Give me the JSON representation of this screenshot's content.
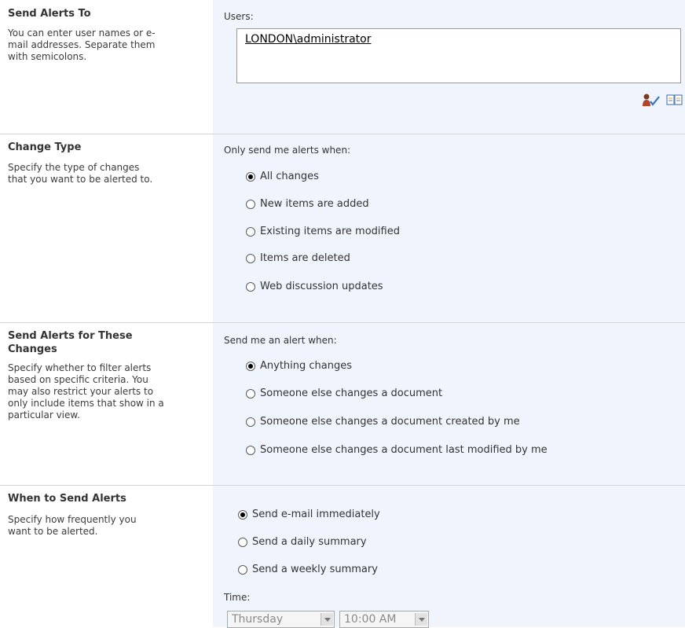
{
  "send_alerts_to": {
    "title": "Send Alerts To",
    "description": "You can enter user names or e-\nmail addresses. Separate them\nwith semicolons.",
    "users_label": "Users:",
    "users_value": "LONDON\\administrator",
    "check_names_icon": "check-names-icon",
    "address_book_icon": "address-book-icon"
  },
  "change_type": {
    "title": "Change Type",
    "description": "Specify the type of changes\nthat you want to be alerted to.",
    "prompt": "Only send me alerts when:",
    "options": [
      "All changes",
      "New items are added",
      "Existing items are modified",
      "Items are deleted",
      "Web discussion updates"
    ],
    "selected": "All changes"
  },
  "filter_changes": {
    "title": "Send Alerts for These Changes",
    "description": "Specify whether to filter alerts\nbased on specific criteria. You\nmay also restrict your alerts to\nonly include items that show in a\nparticular view.",
    "prompt": "Send me an alert when:",
    "options": [
      "Anything changes",
      "Someone else changes a document",
      "Someone else changes a document created by me",
      "Someone else changes a document last modified by me"
    ],
    "selected": "Anything changes"
  },
  "when_to_send": {
    "title": "When to Send Alerts",
    "description": "Specify how frequently you\nwant to be alerted.",
    "options": [
      "Send e-mail immediately",
      "Send a daily summary",
      "Send a weekly summary"
    ],
    "selected": "Send e-mail immediately",
    "time_label": "Time:",
    "day_value": "Thursday",
    "time_value": "10:00 AM"
  }
}
